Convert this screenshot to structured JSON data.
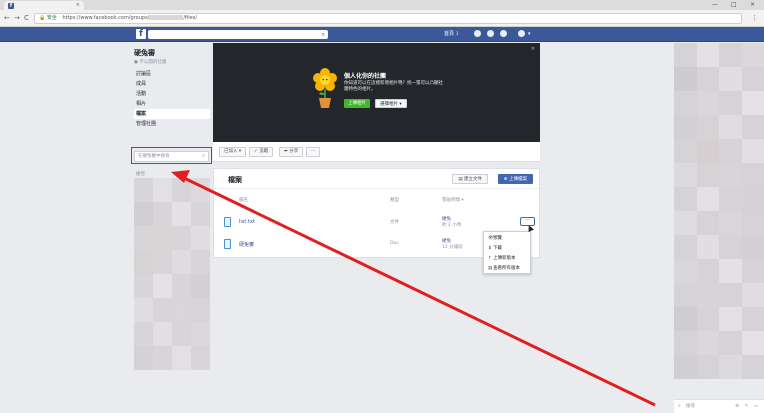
{
  "browser": {
    "tab_close": "×",
    "window_controls": [
      "—",
      "□",
      "×"
    ],
    "nav": {
      "back": "←",
      "forward": "→",
      "reload": "C"
    },
    "secure_label": "安全",
    "url_prefix": "https://www.facebook.com/groups/",
    "url_suffix": "/files/",
    "menu": "⋮"
  },
  "fb_header": {
    "logo": "f",
    "home_label": "首頁",
    "home_badge": "1"
  },
  "group": {
    "name": "硬兔審",
    "privacy": "● 不公開的社團",
    "nav": [
      {
        "label": "討論區",
        "active": false
      },
      {
        "label": "成員",
        "active": false
      },
      {
        "label": "活動",
        "active": false
      },
      {
        "label": "相片",
        "active": false
      },
      {
        "label": "檔案",
        "active": true
      },
      {
        "label": "管理社團",
        "active": false
      }
    ],
    "search_placeholder": "在硬兔審中搜尋",
    "shortcuts_label": "捷徑"
  },
  "cover": {
    "close": "×",
    "heading": "個人化你的社團",
    "desc": "你知道可以在這裡新增相片嗎？找一張可以凸顯社團特色的相片。",
    "upload_btn": "上傳相片",
    "choose_btn": "選擇相片 ▾"
  },
  "action_bar": {
    "joined": "已加入 ▾",
    "following": "✓ 追蹤",
    "share": "➦ 分享",
    "more": "···"
  },
  "files": {
    "title": "檔案",
    "create_doc_btn": "建立文件",
    "upload_btn": "上傳檔案",
    "columns": [
      "檔名",
      "類型",
      "張貼時間 ▾"
    ],
    "rows": [
      {
        "name": "list.txt",
        "type": "文件",
        "author": "硬兔",
        "time": "約 2 小時"
      },
      {
        "name": "硬兔審",
        "type": "Doc",
        "author": "硬兔",
        "time": "11 分鐘前"
      }
    ],
    "more_btn": "···",
    "menu": [
      {
        "icon": "👁",
        "label": "預覽"
      },
      {
        "icon": "⬇",
        "label": "下載"
      },
      {
        "icon": "↑",
        "label": "上傳新版本"
      },
      {
        "icon": "▤",
        "label": "查看所有版本"
      }
    ]
  },
  "chat": {
    "search_placeholder": "搜尋",
    "icons": "⚙ ✎ ▭"
  },
  "colors": {
    "fb_blue": "#3b5998",
    "annotation_red": "#e02020"
  }
}
